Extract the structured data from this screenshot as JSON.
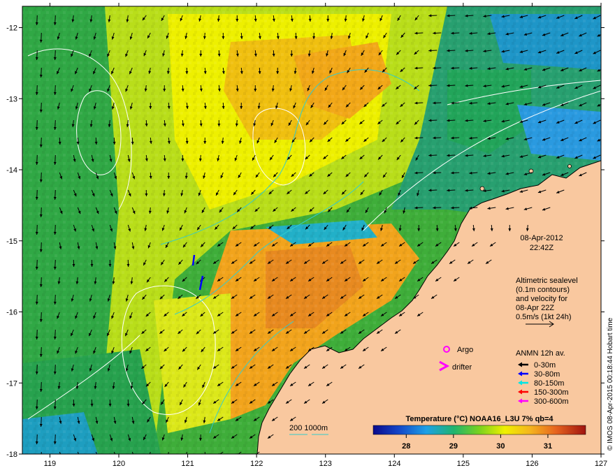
{
  "map": {
    "lon_ticks": [
      "119",
      "120",
      "121",
      "122",
      "123",
      "124",
      "125",
      "126",
      "127"
    ],
    "lat_ticks": [
      "-12",
      "-13",
      "-14",
      "-15",
      "-16",
      "-17",
      "-18"
    ],
    "lon_range": [
      118.6,
      127.0
    ],
    "lat_range": [
      -11.7,
      -18.0
    ]
  },
  "info": {
    "date": "08-Apr-2012",
    "time": "22:42Z",
    "altimetry_lines": [
      "Altimetric sealevel",
      "(0.1m contours)",
      "and velocity for",
      "08-Apr 22Z",
      "0.5m/s (1kt 24h)"
    ]
  },
  "legend": {
    "argo_label": "Argo",
    "drifter_label": "drifter",
    "anmn_title": "ANMN 12h av.",
    "depth_classes": [
      {
        "label": "0-30m",
        "color": "#000000"
      },
      {
        "label": "30-80m",
        "color": "#0000ff"
      },
      {
        "label": "80-150m",
        "color": "#00e5e5"
      },
      {
        "label": "150-300m",
        "color": "#ff0000"
      },
      {
        "label": "300-600m",
        "color": "#ff00ff"
      }
    ],
    "isobath_label": "200  1000m"
  },
  "colorbar": {
    "title": "Temperature (°C) NOAA16_L3U 7% qb=4",
    "ticks": [
      "28",
      "29",
      "30",
      "31"
    ],
    "range": [
      27.3,
      31.8
    ]
  },
  "credit": "© IMOS 08-Apr-2015 00:18:44 Hobart time",
  "colors": {
    "land": "#f9c89f",
    "ocean_cool": "#1fa84a",
    "ocean_warm": "#e6e600",
    "ocean_hot": "#f29a1a",
    "isobath": "#33cccc",
    "contour": "#ffffff",
    "arrow": "#000000"
  }
}
